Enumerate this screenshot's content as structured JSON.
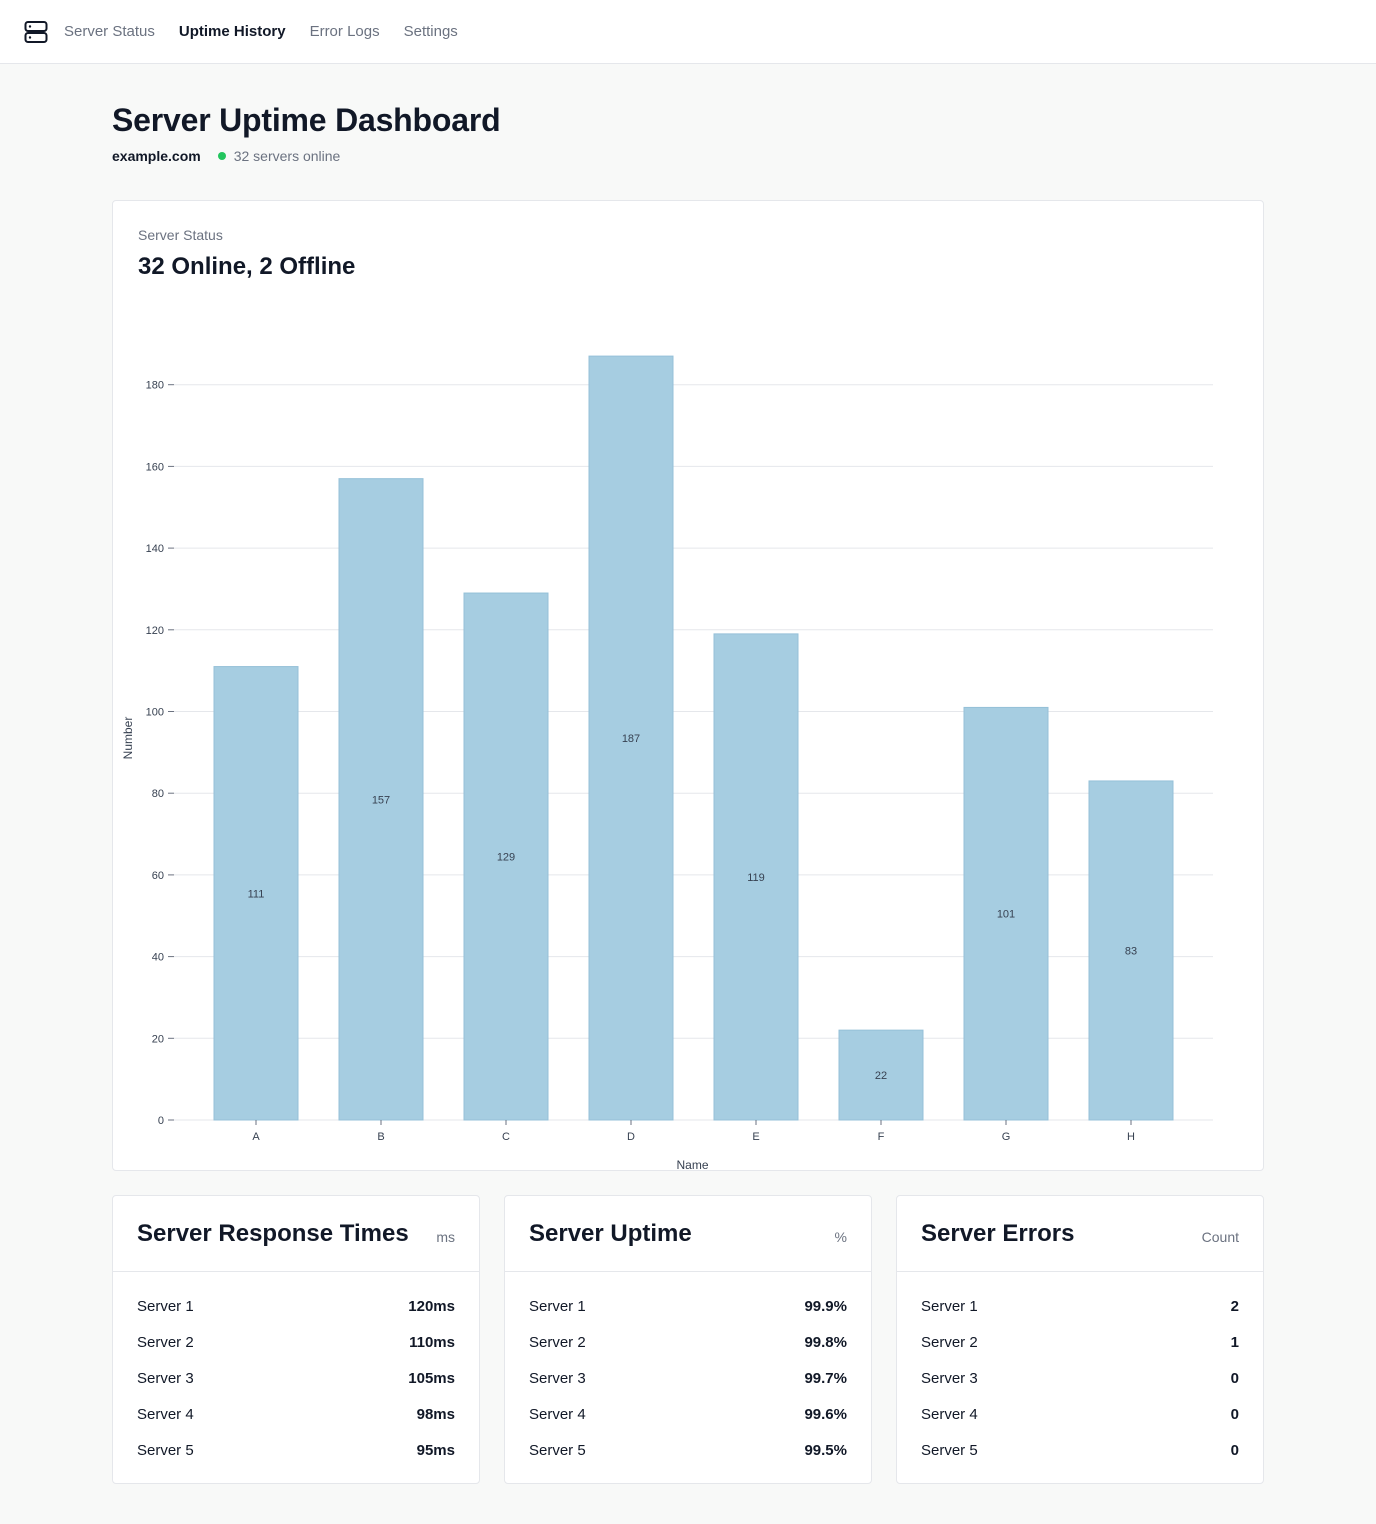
{
  "nav": {
    "items": [
      {
        "label": "Server Status",
        "active": false
      },
      {
        "label": "Uptime History",
        "active": true
      },
      {
        "label": "Error Logs",
        "active": false
      },
      {
        "label": "Settings",
        "active": false
      }
    ]
  },
  "header": {
    "title": "Server Uptime Dashboard",
    "domain": "example.com",
    "online_text": "32 servers online",
    "status_color": "#22c55e"
  },
  "status_card": {
    "label": "Server Status",
    "headline": "32 Online, 2 Offline"
  },
  "chart_data": {
    "type": "bar",
    "categories": [
      "A",
      "B",
      "C",
      "D",
      "E",
      "F",
      "G",
      "H"
    ],
    "values": [
      111,
      157,
      129,
      187,
      119,
      22,
      101,
      83
    ],
    "xlabel": "Name",
    "ylabel": "Number",
    "ylim": [
      0,
      180
    ],
    "yticks": [
      0,
      20,
      40,
      60,
      80,
      100,
      120,
      140,
      160,
      180
    ],
    "grid": true,
    "bar_color": "#a6cde1",
    "data_labels": true
  },
  "response_card": {
    "title": "Server Response Times",
    "unit": "ms",
    "rows": [
      {
        "name": "Server 1",
        "value": "120ms"
      },
      {
        "name": "Server 2",
        "value": "110ms"
      },
      {
        "name": "Server 3",
        "value": "105ms"
      },
      {
        "name": "Server 4",
        "value": "98ms"
      },
      {
        "name": "Server 5",
        "value": "95ms"
      }
    ]
  },
  "uptime_card": {
    "title": "Server Uptime",
    "unit": "%",
    "rows": [
      {
        "name": "Server 1",
        "value": "99.9%"
      },
      {
        "name": "Server 2",
        "value": "99.8%"
      },
      {
        "name": "Server 3",
        "value": "99.7%"
      },
      {
        "name": "Server 4",
        "value": "99.6%"
      },
      {
        "name": "Server 5",
        "value": "99.5%"
      }
    ]
  },
  "errors_card": {
    "title": "Server Errors",
    "unit": "Count",
    "rows": [
      {
        "name": "Server 1",
        "value": "2"
      },
      {
        "name": "Server 2",
        "value": "1"
      },
      {
        "name": "Server 3",
        "value": "0"
      },
      {
        "name": "Server 4",
        "value": "0"
      },
      {
        "name": "Server 5",
        "value": "0"
      }
    ]
  }
}
